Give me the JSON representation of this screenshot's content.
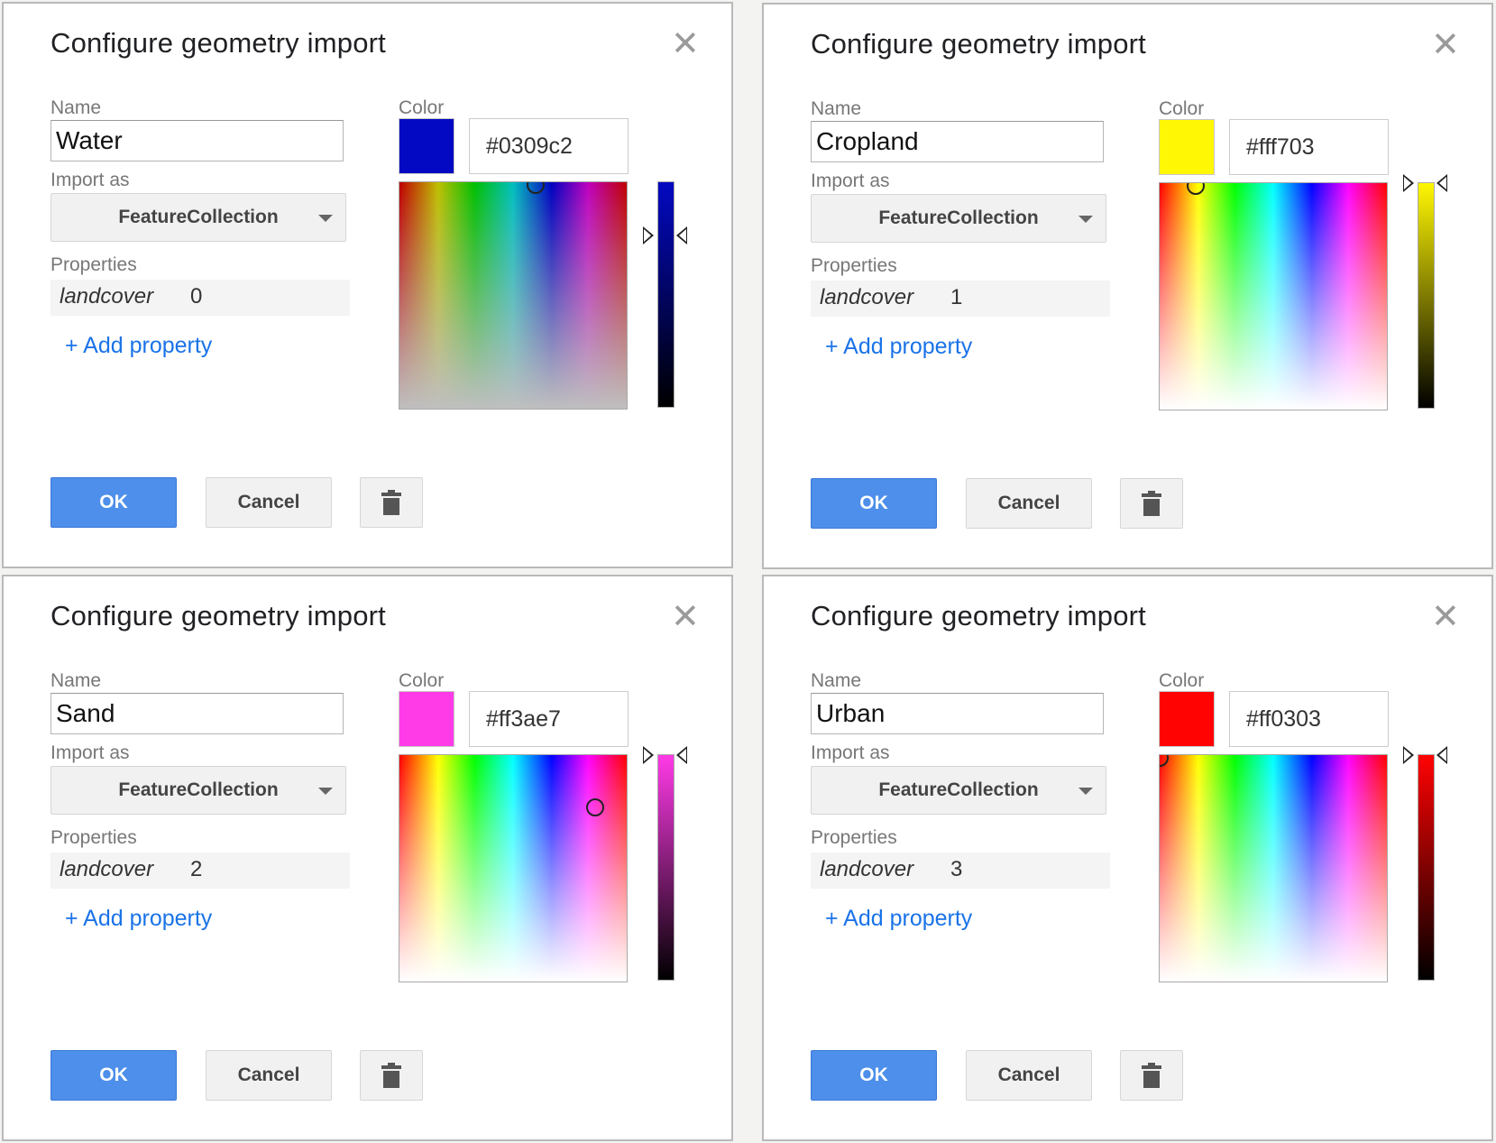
{
  "dialogs": [
    {
      "title": "Configure geometry import",
      "close_symbol": "✕",
      "name_label": "Name",
      "name_value": "Water",
      "import_label": "Import as",
      "import_value": "FeatureCollection",
      "properties_label": "Properties",
      "property_key": "landcover",
      "property_value": "0",
      "add_property": "+ Add property",
      "color_label": "Color",
      "color_hex": "#0309c2",
      "swatch_color": "#0309c2",
      "ok_label": "OK",
      "cancel_label": "Cancel"
    },
    {
      "title": "Configure geometry import",
      "close_symbol": "✕",
      "name_label": "Name",
      "name_value": "Cropland",
      "import_label": "Import as",
      "import_value": "FeatureCollection",
      "properties_label": "Properties",
      "property_key": "landcover",
      "property_value": "1",
      "add_property": "+ Add property",
      "color_label": "Color",
      "color_hex": "#fff703",
      "swatch_color": "#fff703",
      "ok_label": "OK",
      "cancel_label": "Cancel"
    },
    {
      "title": "Configure geometry import",
      "close_symbol": "✕",
      "name_label": "Name",
      "name_value": "Sand",
      "import_label": "Import as",
      "import_value": "FeatureCollection",
      "properties_label": "Properties",
      "property_key": "landcover",
      "property_value": "2",
      "add_property": "+ Add property",
      "color_label": "Color",
      "color_hex": "#ff3ae7",
      "swatch_color": "#ff3ae7",
      "ok_label": "OK",
      "cancel_label": "Cancel"
    },
    {
      "title": "Configure geometry import",
      "close_symbol": "✕",
      "name_label": "Name",
      "name_value": "Urban",
      "import_label": "Import as",
      "import_value": "FeatureCollection",
      "properties_label": "Properties",
      "property_key": "landcover",
      "property_value": "3",
      "add_property": "+ Add property",
      "color_label": "Color",
      "color_hex": "#ff0303",
      "swatch_color": "#ff0303",
      "ok_label": "OK",
      "cancel_label": "Cancel"
    }
  ],
  "colors": {
    "ok_button": "#4d8fea",
    "link": "#1a73e8"
  },
  "icons": {
    "close": "close-icon",
    "dropdown": "chevron-down-icon",
    "delete": "trash-icon"
  }
}
